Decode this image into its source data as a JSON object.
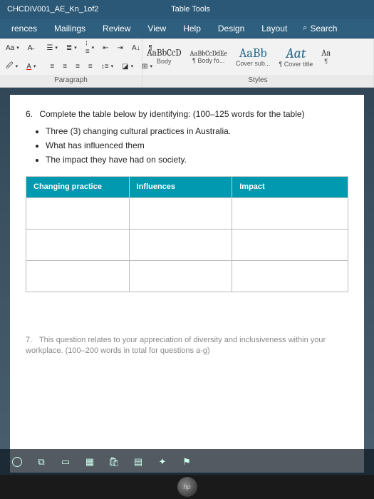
{
  "title": {
    "document": "CHCDIV001_AE_Kn_1of2",
    "context": "Table Tools"
  },
  "menu": {
    "items": [
      "rences",
      "Mailings",
      "Review",
      "View",
      "Help",
      "Design",
      "Layout"
    ],
    "search": "Search"
  },
  "ribbon": {
    "font_sample": "Aa",
    "paragraph_label": "Paragraph",
    "styles_label": "Styles",
    "styles": [
      {
        "preview": "AaBbCcD",
        "name": "Body"
      },
      {
        "preview": "AaBbCcDdEe",
        "name": "¶ Body fo..."
      },
      {
        "preview": "AaBb",
        "name": "Cover sub..."
      },
      {
        "preview": "Aat",
        "name": "¶ Cover title"
      },
      {
        "preview": "Aa",
        "name": "¶"
      }
    ]
  },
  "doc": {
    "q6": {
      "num": "6.",
      "text": "Complete the table below by identifying: (100–125 words for the table)",
      "bullets": [
        "Three (3) changing cultural practices in Australia.",
        "What has influenced them",
        "The impact they have had on society."
      ],
      "headers": [
        "Changing practice",
        "Influences",
        "Impact"
      ]
    },
    "q7": {
      "num": "7.",
      "text": "This question relates to your appreciation of diversity and inclusiveness within your workplace. (100–200 words in total for questions a-g)"
    }
  },
  "logo": "hp"
}
